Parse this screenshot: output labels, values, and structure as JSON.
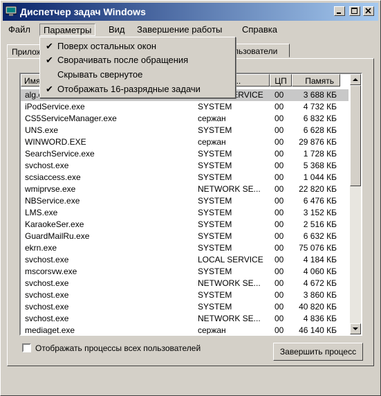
{
  "window": {
    "title": "Диспетчер задач Windows"
  },
  "menu": [
    "Файл",
    "Параметры",
    "Вид",
    "Завершение работы",
    "Справка"
  ],
  "tabs": {
    "left_partial": "Прилож",
    "right_partial": "льзователи"
  },
  "dropdown": [
    {
      "label": "Поверх остальных окон",
      "checked": true
    },
    {
      "label": "Сворачивать после обращения",
      "checked": true
    },
    {
      "label": "Скрывать свернутое",
      "checked": false
    },
    {
      "label": "Отображать 16-разрядные задачи",
      "checked": true
    }
  ],
  "table": {
    "headers": [
      "Имя",
      "Пользова...",
      "ЦП",
      "Память"
    ],
    "rows": [
      [
        "alg.exe",
        "LOCAL SERVICE",
        "00",
        "3 688 КБ"
      ],
      [
        "iPodService.exe",
        "SYSTEM",
        "00",
        "4 732 КБ"
      ],
      [
        "CS5ServiceManager.exe",
        "сержан",
        "00",
        "6 832 КБ"
      ],
      [
        "UNS.exe",
        "SYSTEM",
        "00",
        "6 628 КБ"
      ],
      [
        "WINWORD.EXE",
        "сержан",
        "00",
        "29 876 КБ"
      ],
      [
        "SearchService.exe",
        "SYSTEM",
        "00",
        "1 728 КБ"
      ],
      [
        "svchost.exe",
        "SYSTEM",
        "00",
        "5 368 КБ"
      ],
      [
        "scsiaccess.exe",
        "SYSTEM",
        "00",
        "1 044 КБ"
      ],
      [
        "wmiprvse.exe",
        "NETWORK SE...",
        "00",
        "22 820 КБ"
      ],
      [
        "NBService.exe",
        "SYSTEM",
        "00",
        "6 476 КБ"
      ],
      [
        "LMS.exe",
        "SYSTEM",
        "00",
        "3 152 КБ"
      ],
      [
        "KaraokeSer.exe",
        "SYSTEM",
        "00",
        "2 516 КБ"
      ],
      [
        "GuardMailRu.exe",
        "SYSTEM",
        "00",
        "6 632 КБ"
      ],
      [
        "ekrn.exe",
        "SYSTEM",
        "00",
        "75 076 КБ"
      ],
      [
        "svchost.exe",
        "LOCAL SERVICE",
        "00",
        "4 184 КБ"
      ],
      [
        "mscorsvw.exe",
        "SYSTEM",
        "00",
        "4 060 КБ"
      ],
      [
        "svchost.exe",
        "NETWORK SE...",
        "00",
        "4 672 КБ"
      ],
      [
        "svchost.exe",
        "SYSTEM",
        "00",
        "3 860 КБ"
      ],
      [
        "svchost.exe",
        "SYSTEM",
        "00",
        "40 820 КБ"
      ],
      [
        "svchost.exe",
        "NETWORK SE...",
        "00",
        "4 836 КБ"
      ],
      [
        "mediaget.exe",
        "сержан",
        "00",
        "46 140 КБ"
      ]
    ]
  },
  "footer": {
    "show_all_label": "Отображать процессы всех пользователей",
    "end_process_label": "Завершить процесс"
  }
}
